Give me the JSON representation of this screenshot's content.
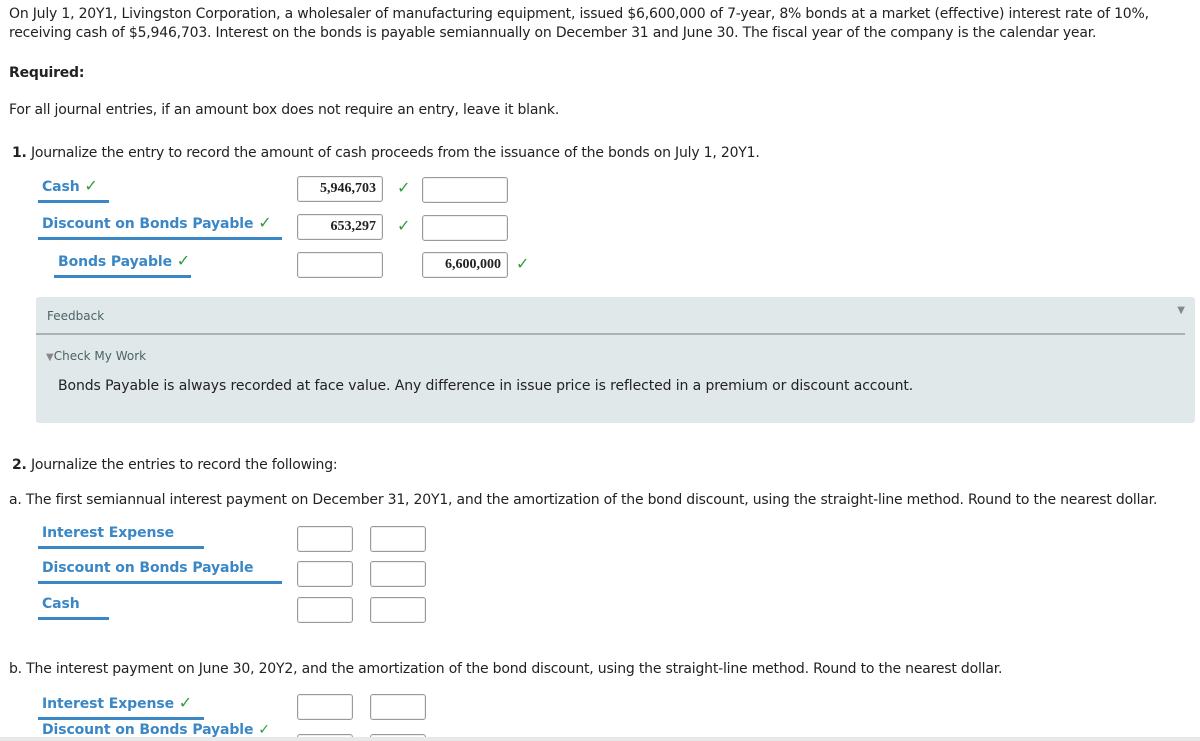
{
  "intro": {
    "line1": "On July 1, 20Y1, Livingston Corporation, a wholesaler of manufacturing equipment, issued $6,600,000 of 7-year, 8% bonds at a market (effective) interest rate of 10%,",
    "line2": "receiving cash of $5,946,703. Interest on the bonds is payable semiannually on December 31 and June 30. The fiscal year of the company is the calendar year.",
    "required": "Required:",
    "instruction": "For all journal entries, if an amount box does not require an entry, leave it blank."
  },
  "part1": {
    "number": "1.",
    "question": "Journalize the entry to record the amount of cash proceeds from the issuance of the bonds on July 1, 20Y1.",
    "rows": [
      {
        "account": "Cash",
        "debit": "5,946,703",
        "credit": "",
        "account_correct": true,
        "debit_correct": true
      },
      {
        "account": "Discount on Bonds Payable",
        "debit": "653,297",
        "credit": "",
        "account_correct": true,
        "debit_correct": true
      },
      {
        "account": "Bonds Payable",
        "debit": "",
        "credit": "6,600,000",
        "account_correct": true,
        "credit_correct": true
      }
    ],
    "check_glyph": "✓"
  },
  "feedback": {
    "title": "Feedback",
    "check_my_work": "Check My Work",
    "text": "Bonds Payable is always recorded at face value. Any difference in issue price is reflected in a premium or discount account."
  },
  "part2": {
    "number": "2.",
    "question": "Journalize the entries to record the following:",
    "a": {
      "text": "a.  The first semiannual interest payment on December 31, 20Y1, and the amortization of the bond discount, using the straight-line method. Round to the nearest dollar.",
      "rows": [
        {
          "account": "Interest Expense",
          "debit": "",
          "credit": ""
        },
        {
          "account": "Discount on Bonds Payable",
          "debit": "",
          "credit": ""
        },
        {
          "account": "Cash",
          "debit": "",
          "credit": ""
        }
      ]
    },
    "b": {
      "text": "b.  The interest payment on June 30, 20Y2, and the amortization of the bond discount, using the straight-line method. Round to the nearest dollar.",
      "rows": [
        {
          "account": "Interest Expense",
          "debit": "",
          "credit": "",
          "account_correct": true
        },
        {
          "account": "Discount on Bonds Payable",
          "debit": "",
          "credit": "",
          "account_correct": true
        }
      ]
    }
  },
  "colors": {
    "accent": "#3b87c6",
    "check": "#2e9e3b",
    "feedback_bg": "#e1e8ea"
  }
}
